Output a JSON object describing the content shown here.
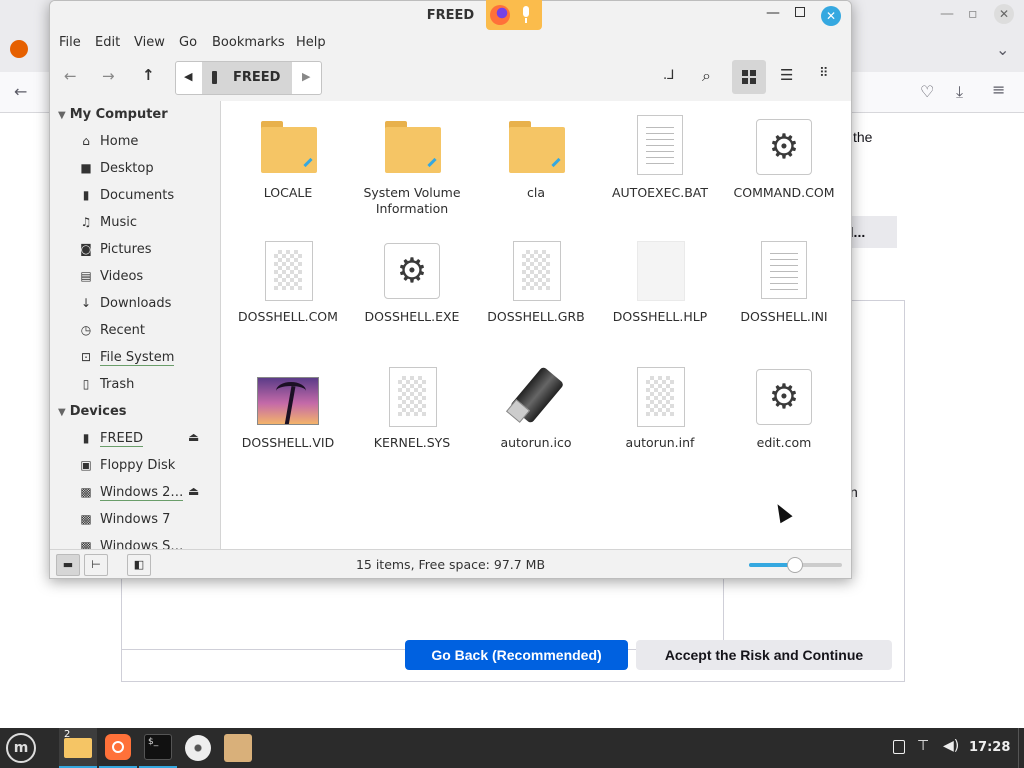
{
  "browser": {
    "partial_text_1": "the",
    "partial_text_2": "n",
    "advanced_button_partial": "d...",
    "go_back_label": "Go Back (Recommended)",
    "accept_label": "Accept the Risk and Continue"
  },
  "window": {
    "title": "FREED",
    "menu": [
      "File",
      "Edit",
      "View",
      "Go",
      "Bookmarks",
      "Help"
    ],
    "path_segment": "FREED"
  },
  "sidebar": {
    "my_computer": {
      "heading": "My Computer",
      "items": [
        {
          "label": "Home",
          "icon": "home-icon"
        },
        {
          "label": "Desktop",
          "icon": "desktop-icon"
        },
        {
          "label": "Documents",
          "icon": "document-icon"
        },
        {
          "label": "Music",
          "icon": "music-icon"
        },
        {
          "label": "Pictures",
          "icon": "camera-icon"
        },
        {
          "label": "Videos",
          "icon": "film-icon"
        },
        {
          "label": "Downloads",
          "icon": "download-icon"
        },
        {
          "label": "Recent",
          "icon": "clock-icon"
        },
        {
          "label": "File System",
          "icon": "drive-icon"
        },
        {
          "label": "Trash",
          "icon": "trash-icon"
        }
      ]
    },
    "devices": {
      "heading": "Devices",
      "items": [
        {
          "label": "FREED",
          "icon": "usb-icon",
          "eject": true
        },
        {
          "label": "Floppy Disk",
          "icon": "floppy-icon",
          "eject": false
        },
        {
          "label": "Windows 2…",
          "icon": "disk-icon",
          "eject": true
        },
        {
          "label": "Windows 7",
          "icon": "disk-icon",
          "eject": false
        },
        {
          "label": "Windows S…",
          "icon": "disk-icon",
          "eject": false
        }
      ]
    }
  },
  "files": [
    {
      "name": "LOCALE",
      "type": "folder"
    },
    {
      "name": "System Volume Information",
      "type": "folder"
    },
    {
      "name": "cla",
      "type": "folder"
    },
    {
      "name": "AUTOEXEC.BAT",
      "type": "text"
    },
    {
      "name": "COMMAND.COM",
      "type": "executable"
    },
    {
      "name": "DOSSHELL.COM",
      "type": "unknown"
    },
    {
      "name": "DOSSHELL.EXE",
      "type": "executable"
    },
    {
      "name": "DOSSHELL.GRB",
      "type": "unknown"
    },
    {
      "name": "DOSSHELL.HLP",
      "type": "blank"
    },
    {
      "name": "DOSSHELL.INI",
      "type": "text"
    },
    {
      "name": "DOSSHELL.VID",
      "type": "image"
    },
    {
      "name": "KERNEL.SYS",
      "type": "unknown"
    },
    {
      "name": "autorun.ico",
      "type": "usb"
    },
    {
      "name": "autorun.inf",
      "type": "unknown"
    },
    {
      "name": "edit.com",
      "type": "executable"
    }
  ],
  "status": {
    "text": "15 items, Free space: 97.7 MB",
    "zoom_level": 0.5
  },
  "taskbar": {
    "workspace_badge": "2",
    "clock": "17:28"
  },
  "colors": {
    "folder": "#f5c565",
    "accent": "#35a8e0",
    "close_button": "#35a8e0",
    "taskbar": "#2b2b2b",
    "primary_button": "#0061e0",
    "recording_indicator": "#fbbc4c"
  }
}
